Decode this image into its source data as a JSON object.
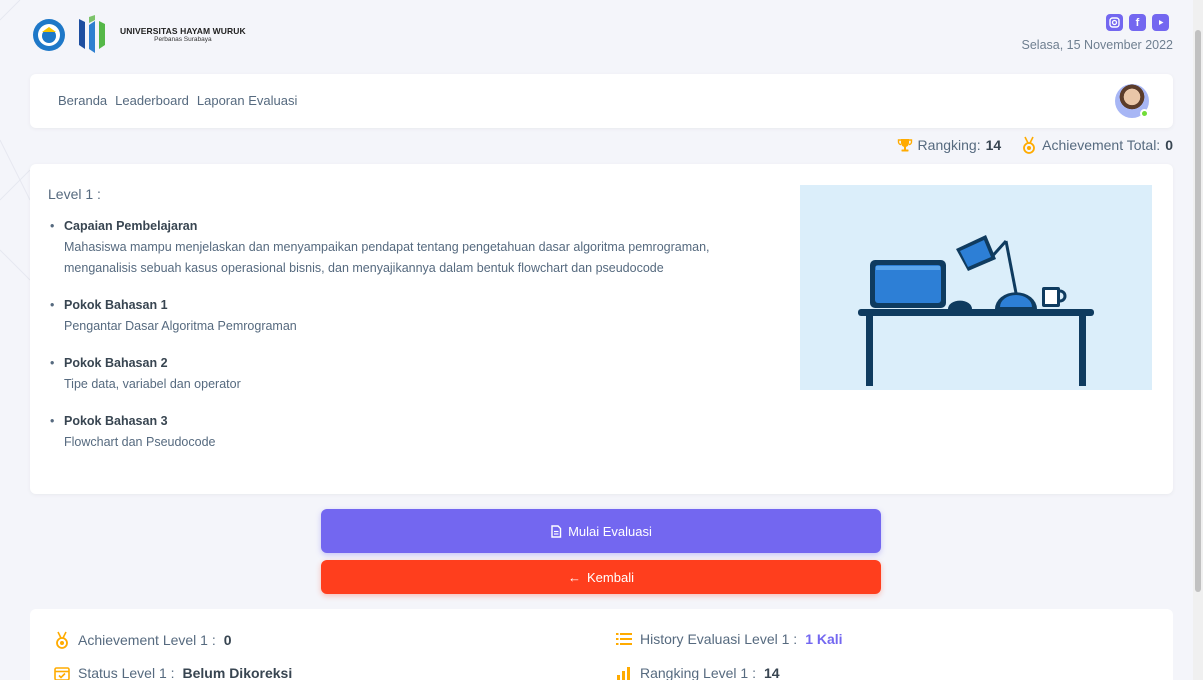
{
  "header": {
    "logo_title": "UNIVERSITAS HAYAM WURUK",
    "logo_subtitle": "Perbanas Surabaya",
    "date": "Selasa, 15 November 2022",
    "social_icons": [
      "instagram-icon",
      "facebook-icon",
      "youtube-icon"
    ]
  },
  "nav": {
    "items": [
      "Beranda",
      "Leaderboard",
      "Laporan Evaluasi"
    ]
  },
  "stats": {
    "rank_label": "Rangking:",
    "rank_value": "14",
    "achievement_label": "Achievement Total:",
    "achievement_value": "0"
  },
  "level": {
    "title": "Level 1 :",
    "items": [
      {
        "title": "Capaian Pembelajaran",
        "desc": "Mahasiswa mampu menjelaskan dan menyampaikan pendapat tentang pengetahuan dasar algoritma pemrograman, menganalisis sebuah kasus operasional bisnis, dan menyajikannya dalam bentuk flowchart dan pseudocode"
      },
      {
        "title": "Pokok Bahasan 1",
        "desc": "Pengantar Dasar Algoritma Pemrograman"
      },
      {
        "title": "Pokok Bahasan 2",
        "desc": "Tipe data, variabel dan operator"
      },
      {
        "title": "Pokok Bahasan 3",
        "desc": "Flowchart dan Pseudocode"
      }
    ]
  },
  "buttons": {
    "start": "Mulai Evaluasi",
    "back": "Kembali"
  },
  "summary": {
    "achievement_label": "Achievement Level 1 :",
    "achievement_value": "0",
    "history_label": "History Evaluasi Level 1 :",
    "history_value": "1 Kali",
    "status_label": "Status Level 1 :",
    "status_value": "Belum Dikoreksi",
    "rank_label": "Rangking Level 1 :",
    "rank_value": "14"
  },
  "colors": {
    "primary": "#7367f0",
    "danger": "#ff3e1d",
    "warning": "#ffab00",
    "background": "#f4f5fa"
  }
}
